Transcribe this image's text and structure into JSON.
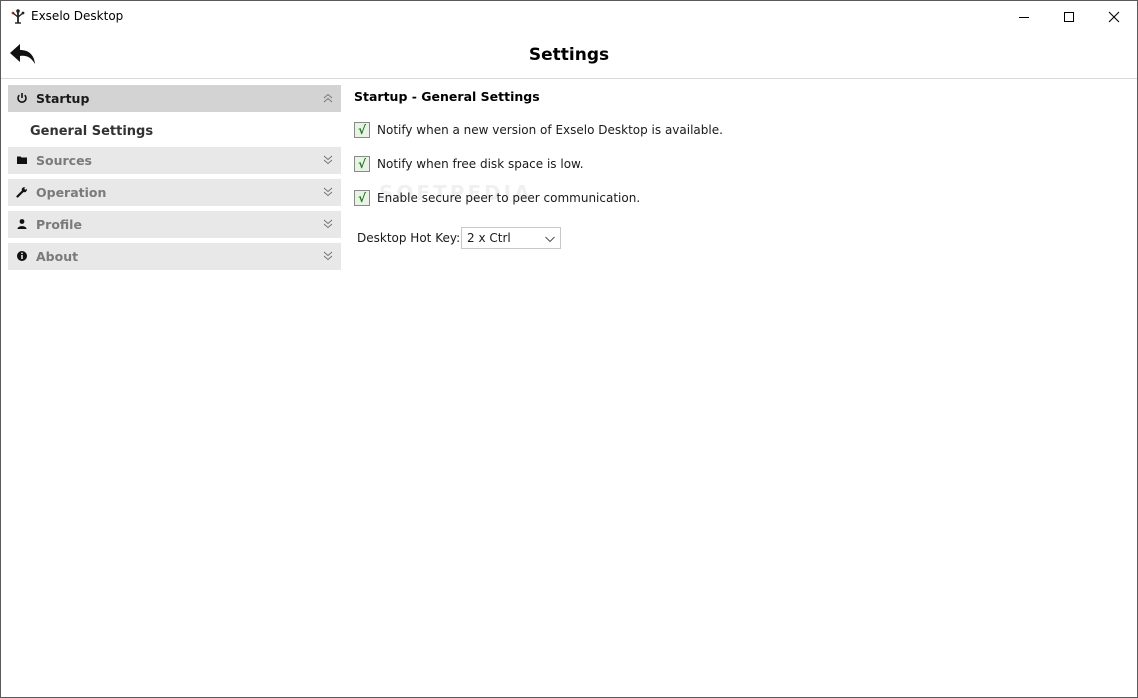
{
  "window": {
    "title": "Exselo Desktop"
  },
  "header": {
    "title": "Settings"
  },
  "sidebar": {
    "sections": [
      {
        "label": "Startup",
        "icon": "power-icon",
        "expanded": true,
        "subitems": [
          "General Settings"
        ]
      },
      {
        "label": "Sources",
        "icon": "folder-icon",
        "expanded": false
      },
      {
        "label": "Operation",
        "icon": "wrench-icon",
        "expanded": false
      },
      {
        "label": "Profile",
        "icon": "user-icon",
        "expanded": false
      },
      {
        "label": "About",
        "icon": "info-icon",
        "expanded": false
      }
    ]
  },
  "content": {
    "title": "Startup - General Settings",
    "options": [
      {
        "label": "Notify when a new version of Exselo Desktop is available.",
        "checked": true,
        "mark": "√"
      },
      {
        "label": "Notify when free disk space is low.",
        "checked": true,
        "mark": "√"
      },
      {
        "label": "Enable secure peer to peer communication.",
        "checked": true,
        "mark": "√"
      }
    ],
    "hotkey": {
      "label": "Desktop Hot Key:",
      "value": "2 x Ctrl"
    }
  },
  "watermark": "SOFTPEDIA"
}
